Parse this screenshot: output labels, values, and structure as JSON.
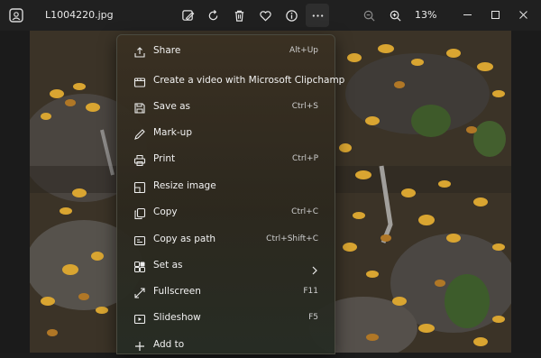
{
  "app": {
    "filename": "L1004220.jpg",
    "zoom": "13%"
  },
  "menu": [
    {
      "label": "Share",
      "shortcut": "Alt+Up",
      "icon": "share-icon"
    },
    {
      "label": "Create a video with Microsoft Clipchamp",
      "shortcut": "",
      "icon": "clipchamp-icon"
    },
    {
      "label": "Save as",
      "shortcut": "Ctrl+S",
      "icon": "save-icon"
    },
    {
      "label": "Mark-up",
      "shortcut": "",
      "icon": "markup-pen-icon"
    },
    {
      "label": "Print",
      "shortcut": "Ctrl+P",
      "icon": "print-icon"
    },
    {
      "label": "Resize image",
      "shortcut": "",
      "icon": "resize-icon"
    },
    {
      "label": "Copy",
      "shortcut": "Ctrl+C",
      "icon": "copy-icon"
    },
    {
      "label": "Copy as path",
      "shortcut": "Ctrl+Shift+C",
      "icon": "copy-path-icon"
    },
    {
      "label": "Set as",
      "shortcut": "",
      "icon": "set-as-icon",
      "submenu": true
    },
    {
      "label": "Fullscreen",
      "shortcut": "F11",
      "icon": "fullscreen-icon"
    },
    {
      "label": "Slideshow",
      "shortcut": "F5",
      "icon": "slideshow-icon"
    },
    {
      "label": "Add to",
      "shortcut": "",
      "icon": "add-icon"
    }
  ]
}
